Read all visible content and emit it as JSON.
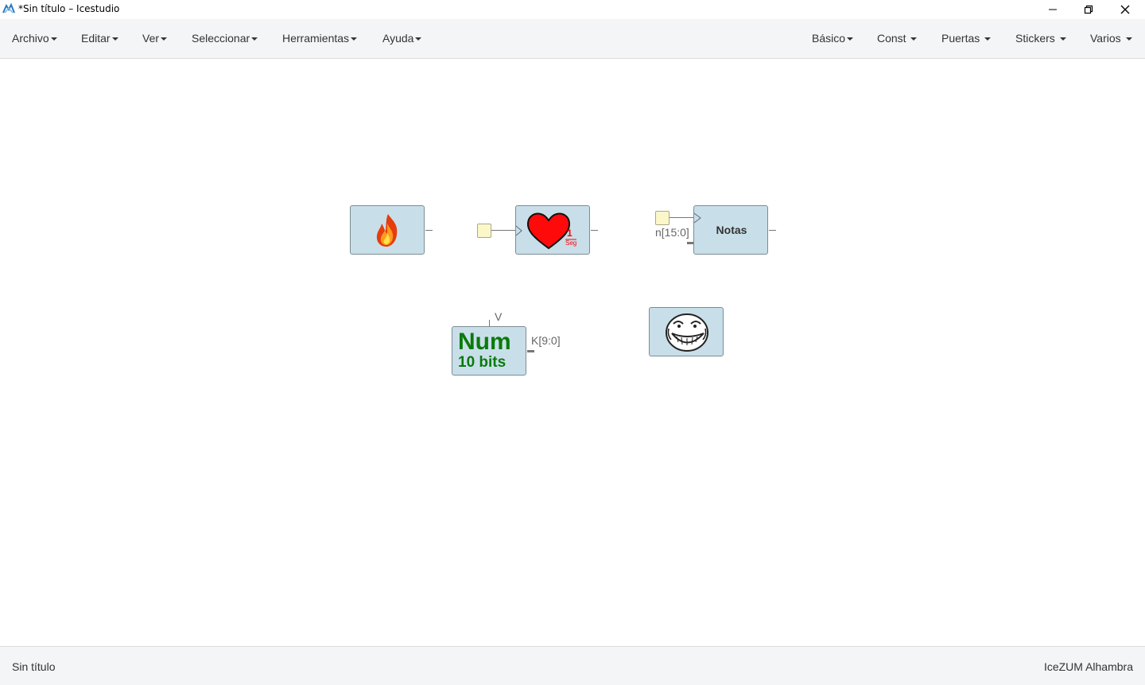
{
  "window": {
    "title": "*Sin título – Icestudio"
  },
  "menu_left": [
    {
      "label": "Archivo"
    },
    {
      "label": "Editar"
    },
    {
      "label": "Ver"
    },
    {
      "label": "Seleccionar"
    },
    {
      "label": "Herramientas"
    },
    {
      "label": "Ayuda"
    }
  ],
  "menu_right": [
    {
      "label": "Básico"
    },
    {
      "label": "Const"
    },
    {
      "label": "Puertas"
    },
    {
      "label": "Stickers"
    },
    {
      "label": "Varios"
    }
  ],
  "blocks": {
    "heart": {
      "value": "1",
      "unit": "Seg",
      "color": "#ff0000"
    },
    "notas": {
      "label": "Notas",
      "port": "n[15:0]"
    },
    "num": {
      "title": "Num",
      "subtitle": "10 bits",
      "port_top": "V",
      "port_out": "K[9:0]",
      "color": "#0a7a0a"
    }
  },
  "status": {
    "file": "Sin título",
    "board": "IceZUM Alhambra"
  },
  "colors": {
    "block_fill": "#c8dfe9",
    "input_fill": "#fbf7c9",
    "menubar": "#f4f5f6"
  }
}
